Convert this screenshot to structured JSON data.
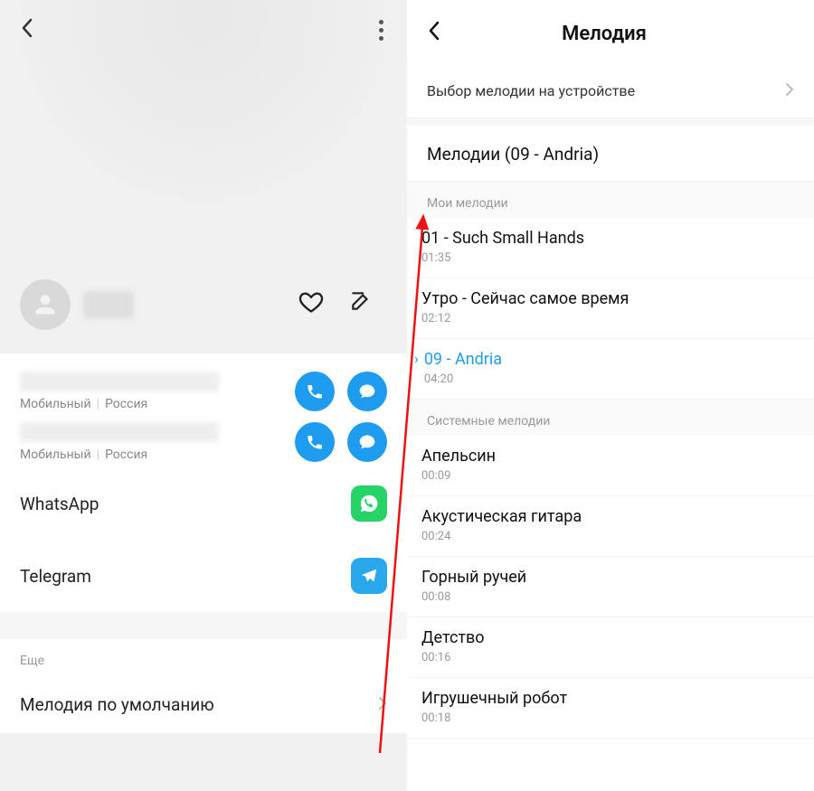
{
  "left": {
    "contact": {
      "phone1_sub_type": "Мобильный",
      "phone1_sub_region": "Россия",
      "phone2_sub_type": "Мобильный",
      "phone2_sub_region": "Россия"
    },
    "apps": {
      "whatsapp": "WhatsApp",
      "telegram": "Telegram"
    },
    "more_section": "Еще",
    "default_ringtone": "Мелодия по умолчанию"
  },
  "right": {
    "title": "Мелодия",
    "pick_on_device": "Выбор мелодии на устройстве",
    "current": "Мелодии (09 - Andria)",
    "group_my": "Мои мелодии",
    "group_system": "Системные мелодии",
    "my": [
      {
        "title": "01 - Such Small Hands",
        "dur": "01:35",
        "selected": false
      },
      {
        "title": "Утро - Сейчас самое время",
        "dur": "02:12",
        "selected": false
      },
      {
        "title": "09 - Andria",
        "dur": "04:20",
        "selected": true
      }
    ],
    "system": [
      {
        "title": "Апельсин",
        "dur": "00:09"
      },
      {
        "title": "Акустическая гитара",
        "dur": "00:24"
      },
      {
        "title": "Горный ручей",
        "dur": "00:08"
      },
      {
        "title": "Детство",
        "dur": "00:16"
      },
      {
        "title": "Игрушечный робот",
        "dur": "00:18"
      }
    ]
  }
}
